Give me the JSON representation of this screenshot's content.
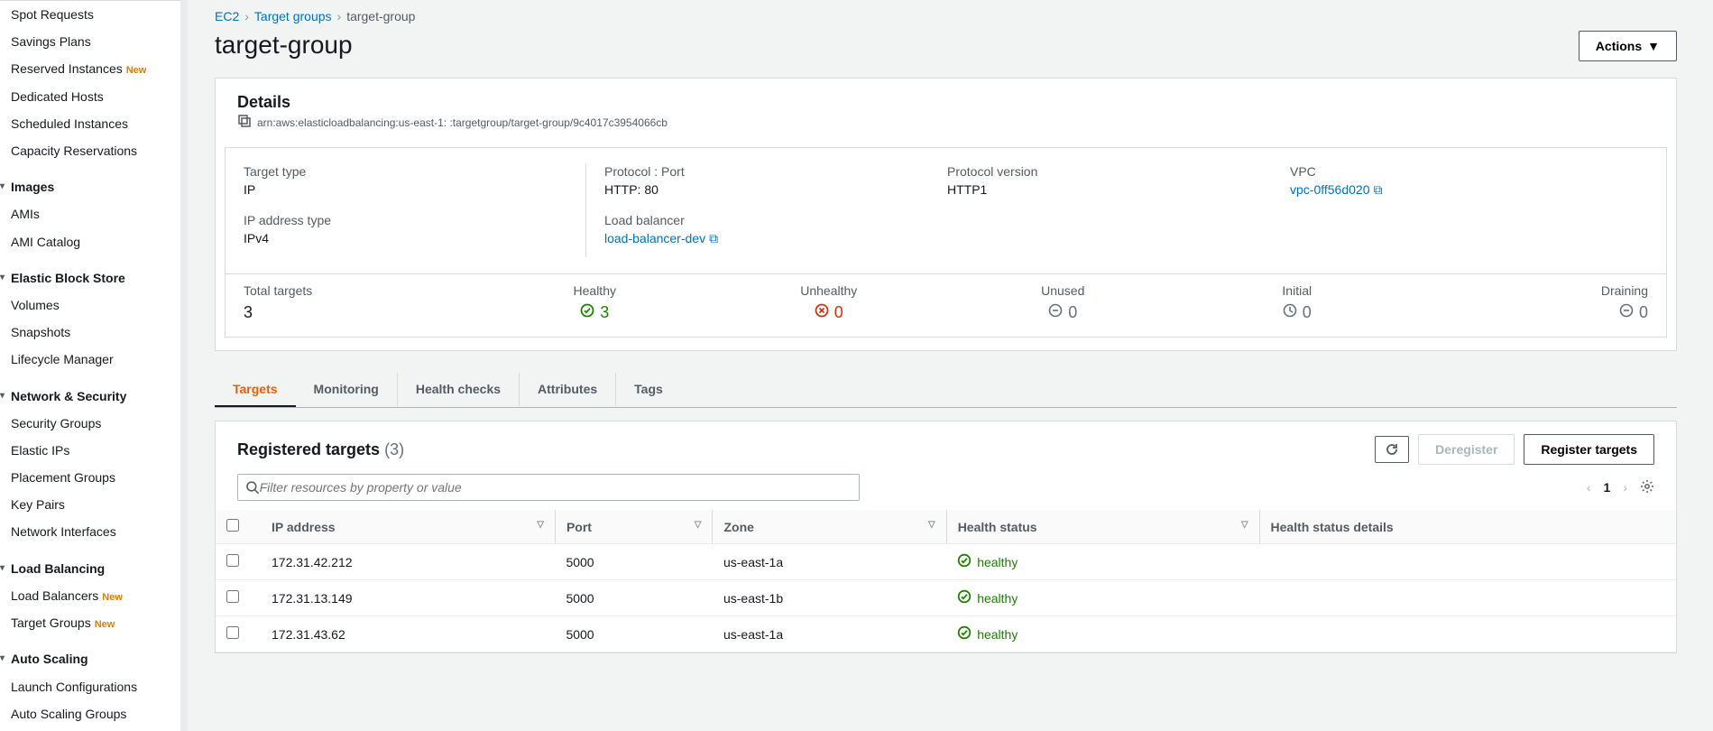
{
  "sidebar": {
    "items": [
      {
        "type": "sub",
        "label": "Spot Requests"
      },
      {
        "type": "sub",
        "label": "Savings Plans"
      },
      {
        "type": "sub",
        "label": "Reserved Instances",
        "tag": "New"
      },
      {
        "type": "sub",
        "label": "Dedicated Hosts"
      },
      {
        "type": "sub",
        "label": "Scheduled Instances"
      },
      {
        "type": "sub",
        "label": "Capacity Reservations"
      },
      {
        "type": "hdr",
        "label": "Images"
      },
      {
        "type": "sub",
        "label": "AMIs"
      },
      {
        "type": "sub",
        "label": "AMI Catalog"
      },
      {
        "type": "hdr",
        "label": "Elastic Block Store"
      },
      {
        "type": "sub",
        "label": "Volumes"
      },
      {
        "type": "sub",
        "label": "Snapshots"
      },
      {
        "type": "sub",
        "label": "Lifecycle Manager"
      },
      {
        "type": "hdr",
        "label": "Network & Security"
      },
      {
        "type": "sub",
        "label": "Security Groups"
      },
      {
        "type": "sub",
        "label": "Elastic IPs"
      },
      {
        "type": "sub",
        "label": "Placement Groups"
      },
      {
        "type": "sub",
        "label": "Key Pairs"
      },
      {
        "type": "sub",
        "label": "Network Interfaces"
      },
      {
        "type": "hdr",
        "label": "Load Balancing"
      },
      {
        "type": "sub",
        "label": "Load Balancers",
        "tag": "New"
      },
      {
        "type": "sub",
        "label": "Target Groups",
        "tag": "New"
      },
      {
        "type": "hdr",
        "label": "Auto Scaling"
      },
      {
        "type": "sub",
        "label": "Launch Configurations"
      },
      {
        "type": "sub",
        "label": "Auto Scaling Groups"
      }
    ]
  },
  "breadcrumbs": [
    {
      "text": "EC2",
      "link": true
    },
    {
      "text": "Target groups",
      "link": true
    },
    {
      "text": "target-group",
      "link": false
    }
  ],
  "page_title": "target-group",
  "actions_btn": "Actions",
  "details": {
    "title": "Details",
    "arn": "arn:aws:elasticloadbalancing:us-east-1:            :targetgroup/target-group/9c4017c3954066cb",
    "labels": {
      "target_type": "Target type",
      "protocol_port": "Protocol : Port",
      "protocol_version": "Protocol version",
      "vpc": "VPC",
      "ip_address_type": "IP address type",
      "load_balancer": "Load balancer"
    },
    "values": {
      "target_type": "IP",
      "protocol_port": "HTTP: 80",
      "protocol_version": "HTTP1",
      "vpc": "vpc-0ff56d020",
      "ip_address_type": "IPv4",
      "load_balancer": "load-balancer-dev"
    }
  },
  "stats": [
    {
      "label": "Total targets",
      "value": "3",
      "icon": "none"
    },
    {
      "label": "Healthy",
      "value": "3",
      "icon": "green-check",
      "color": "#1d8102"
    },
    {
      "label": "Unhealthy",
      "value": "0",
      "icon": "red-x",
      "color": "#d13212"
    },
    {
      "label": "Unused",
      "value": "0",
      "icon": "gray-minus",
      "color": "#687078"
    },
    {
      "label": "Initial",
      "value": "0",
      "icon": "gray-clock",
      "color": "#687078"
    },
    {
      "label": "Draining",
      "value": "0",
      "icon": "gray-minus",
      "color": "#687078"
    }
  ],
  "tabs": [
    "Targets",
    "Monitoring",
    "Health checks",
    "Attributes",
    "Tags"
  ],
  "active_tab": 0,
  "registered": {
    "title": "Registered targets",
    "count": "(3)",
    "refresh": "Refresh",
    "deregister": "Deregister",
    "register": "Register targets",
    "filter_placeholder": "Filter resources by property or value",
    "page": "1",
    "columns": [
      "IP address",
      "Port",
      "Zone",
      "Health status",
      "Health status details"
    ],
    "rows": [
      {
        "ip": "172.31.42.212",
        "port": "5000",
        "zone": "us-east-1a",
        "health": "healthy",
        "details": ""
      },
      {
        "ip": "172.31.13.149",
        "port": "5000",
        "zone": "us-east-1b",
        "health": "healthy",
        "details": ""
      },
      {
        "ip": "172.31.43.62",
        "port": "5000",
        "zone": "us-east-1a",
        "health": "healthy",
        "details": ""
      }
    ]
  }
}
